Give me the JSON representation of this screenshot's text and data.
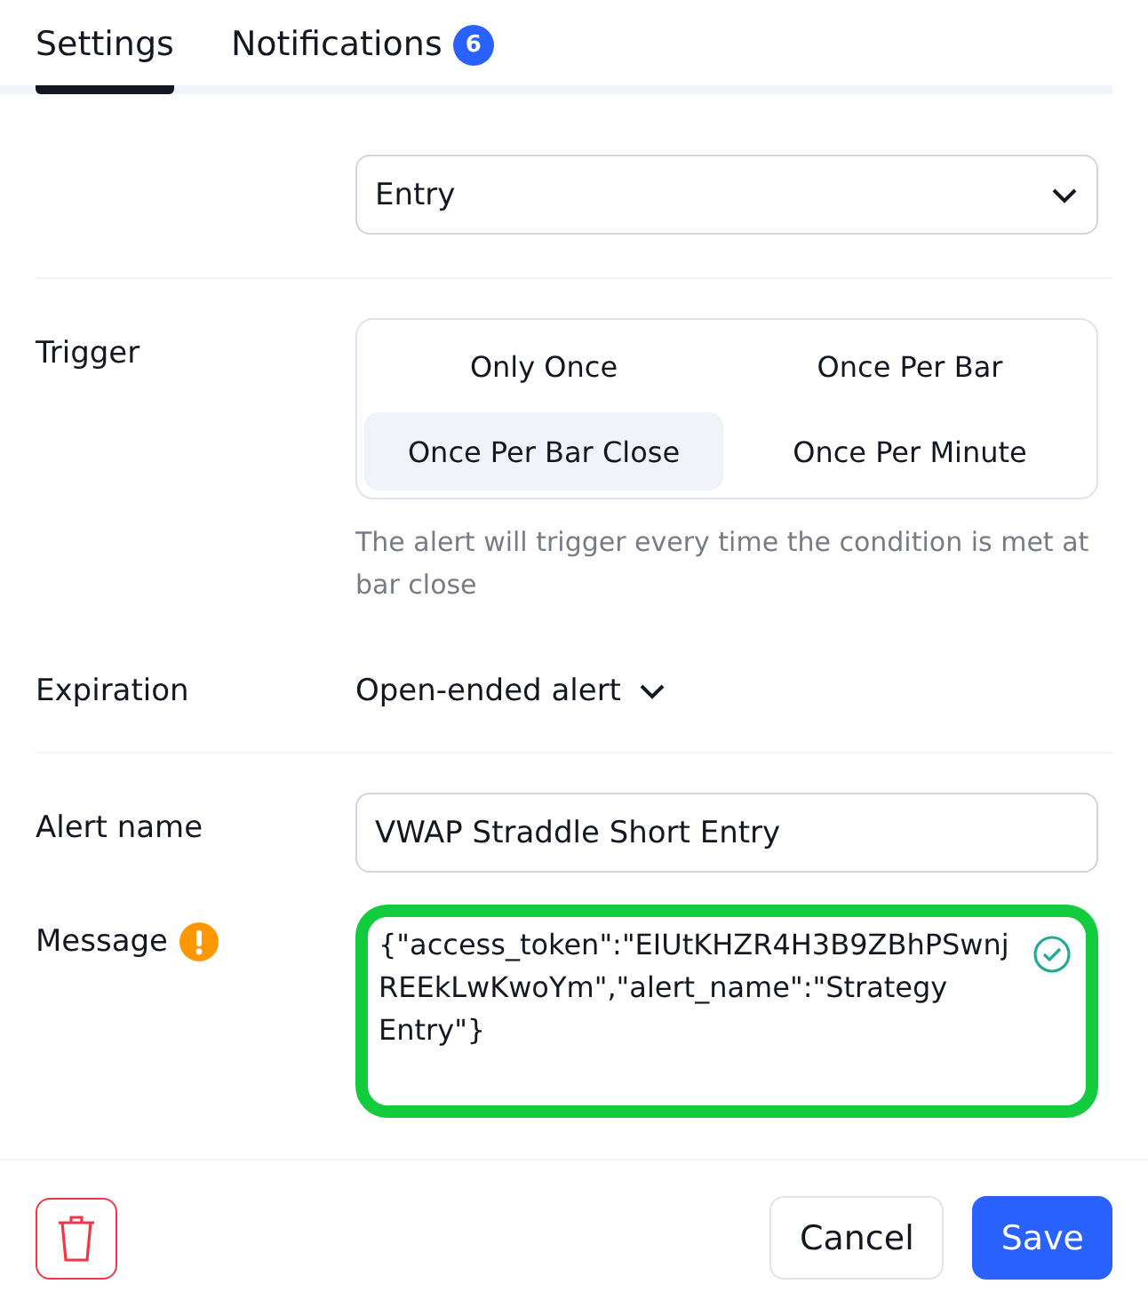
{
  "tabs": [
    {
      "label": "Settings",
      "selected": true
    },
    {
      "label": "Notifications",
      "selected": false,
      "badge": "6"
    }
  ],
  "condition": {
    "value": "Entry"
  },
  "trigger": {
    "label": "Trigger",
    "options": [
      {
        "label": "Only Once",
        "selected": false
      },
      {
        "label": "Once Per Bar",
        "selected": false
      },
      {
        "label": "Once Per Bar Close",
        "selected": true
      },
      {
        "label": "Once Per Minute",
        "selected": false
      }
    ],
    "hint": "The alert will trigger every time the condition is met at bar close"
  },
  "expiration": {
    "label": "Expiration",
    "value": "Open-ended alert"
  },
  "alert_name": {
    "label": "Alert name",
    "value": "VWAP Straddle Short Entry"
  },
  "message": {
    "label": "Message",
    "warning": true,
    "valid": true,
    "value": "{\"access_token\":\"EIUtKHZR4H3B9ZBhPSwnjREEkLwKwoYm\",\"alert_name\":\"Strategy Entry\"}"
  },
  "buttons": {
    "cancel": "Cancel",
    "save": "Save"
  }
}
